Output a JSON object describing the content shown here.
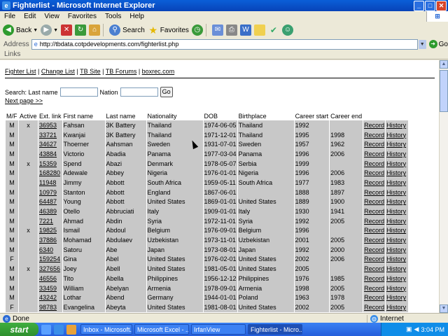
{
  "window": {
    "title": "Fighterlist - Microsoft Internet Explorer"
  },
  "menu": [
    "File",
    "Edit",
    "View",
    "Favorites",
    "Tools",
    "Help"
  ],
  "toolbar": {
    "back": "Back",
    "search": "Search",
    "favorites": "Favorites"
  },
  "address": {
    "label": "Address",
    "url": "http://tbdata.cotpdevelopments.com/fighterlist.php",
    "go": "Go"
  },
  "links_label": "Links",
  "nav": [
    "Fighter List",
    "Change List",
    "TB Site",
    "TB Forums",
    "boxrec.com"
  ],
  "search": {
    "label": "Search: Last name",
    "nation_label": "Nation",
    "go": "Go",
    "next_page": "Next page >>"
  },
  "table": {
    "headers": [
      "M/F",
      "Active",
      "Ext. link",
      "First name",
      "Last name",
      "Nationality",
      "DOB",
      "Birthplace",
      "Career start",
      "Career end",
      "",
      ""
    ],
    "rows": [
      [
        "M",
        "x",
        "36953",
        "Fahsan",
        "3K Battery",
        "Thailand",
        "1974-06-05",
        "Thailand",
        "1992",
        "",
        "Record",
        "History"
      ],
      [
        "M",
        "",
        "33721",
        "Kwanjai",
        "3K Battery",
        "Thailand",
        "1971-12-01",
        "Thailand",
        "1995",
        "1998",
        "Record",
        "History"
      ],
      [
        "M",
        "",
        "34627",
        "Thoerner",
        "Aahsman",
        "Sweden",
        "1931-07-01",
        "Sweden",
        "1957",
        "1962",
        "Record",
        "History"
      ],
      [
        "M",
        "",
        "43884",
        "Victorio",
        "Abadia",
        "Panama",
        "1977-03-04",
        "Panama",
        "1996",
        "2006",
        "Record",
        "History"
      ],
      [
        "M",
        "x",
        "15359",
        "Spend",
        "Abazi",
        "Denmark",
        "1978-05-07",
        "Serbia",
        "1999",
        "",
        "Record",
        "History"
      ],
      [
        "M",
        "",
        "168280",
        "Adewale",
        "Abbey",
        "Nigeria",
        "1976-01-01",
        "Nigeria",
        "1996",
        "2006",
        "Record",
        "History"
      ],
      [
        "M",
        "",
        "11948",
        "Jimmy",
        "Abbott",
        "South Africa",
        "1959-05-11",
        "South Africa",
        "1977",
        "1983",
        "Record",
        "History"
      ],
      [
        "M",
        "",
        "10979",
        "Stanton",
        "Abbott",
        "England",
        "1867-06-01",
        "",
        "1888",
        "1897",
        "Record",
        "History"
      ],
      [
        "M",
        "",
        "64487",
        "Young",
        "Abbott",
        "United States",
        "1869-01-01",
        "United States",
        "1889",
        "1900",
        "Record",
        "History"
      ],
      [
        "M",
        "",
        "46389",
        "Otello",
        "Abbruciati",
        "Italy",
        "1909-01-01",
        "Italy",
        "1930",
        "1941",
        "Record",
        "History"
      ],
      [
        "M",
        "",
        "7221",
        "Ahmad",
        "Abdin",
        "Syria",
        "1972-11-01",
        "Syria",
        "1992",
        "2005",
        "Record",
        "History"
      ],
      [
        "M",
        "x",
        "19825",
        "Ismail",
        "Abdoul",
        "Belgium",
        "1976-09-01",
        "Belgium",
        "1996",
        "",
        "Record",
        "History"
      ],
      [
        "M",
        "",
        "37886",
        "Mohamad",
        "Abdulaev",
        "Uzbekistan",
        "1973-11-01",
        "Uzbekistan",
        "2001",
        "2005",
        "Record",
        "History"
      ],
      [
        "M",
        "",
        "6340",
        "Satoru",
        "Abe",
        "Japan",
        "1973-08-01",
        "Japan",
        "1992",
        "2000",
        "Record",
        "History"
      ],
      [
        "F",
        "",
        "159254",
        "Gina",
        "Abel",
        "United States",
        "1976-02-01",
        "United States",
        "2002",
        "2006",
        "Record",
        "History"
      ],
      [
        "M",
        "x",
        "327656",
        "Joey",
        "Abell",
        "United States",
        "1981-05-01",
        "United States",
        "2005",
        "",
        "Record",
        "History"
      ],
      [
        "M",
        "",
        "46556",
        "Tito",
        "Abella",
        "Philippines",
        "1956-12-12",
        "Philippines",
        "1976",
        "1985",
        "Record",
        "History"
      ],
      [
        "M",
        "",
        "33459",
        "William",
        "Abelyan",
        "Armenia",
        "1978-09-01",
        "Armenia",
        "1998",
        "2005",
        "Record",
        "History"
      ],
      [
        "M",
        "",
        "43242",
        "Lothar",
        "Abend",
        "Germany",
        "1944-01-01",
        "Poland",
        "1963",
        "1978",
        "Record",
        "History"
      ],
      [
        "F",
        "",
        "98783",
        "Evangelina",
        "Abeyta",
        "United States",
        "1981-08-01",
        "United States",
        "2002",
        "2005",
        "Record",
        "History"
      ]
    ]
  },
  "status": {
    "text": "Done",
    "zone": "Internet"
  },
  "taskbar": {
    "start": "start",
    "tasks": [
      "Inbox - Microsoft...",
      "Microsoft Excel - ...",
      "IrfanView",
      "Fighterlist - Micro..."
    ],
    "clock": "3:04 PM"
  }
}
